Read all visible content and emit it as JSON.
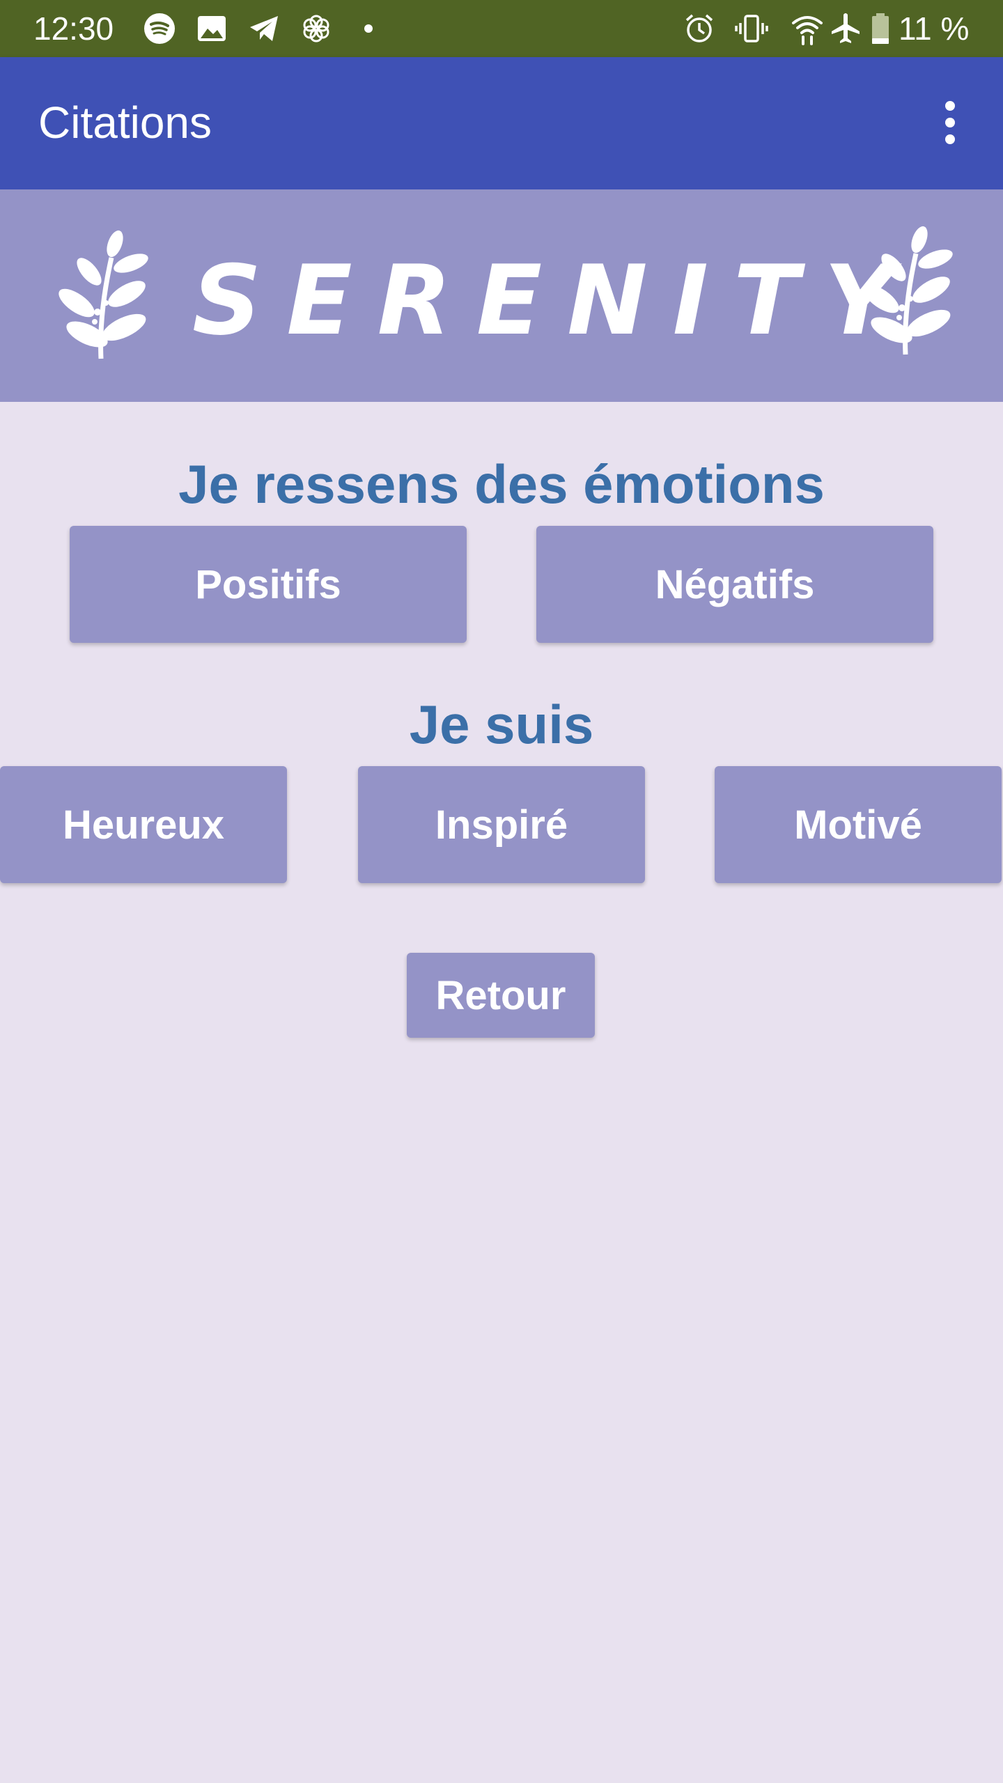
{
  "status_bar": {
    "time": "12:30",
    "battery": "11 %",
    "left_icons": [
      "spotify-icon",
      "image-icon",
      "telegram-icon",
      "flower-icon",
      "dot-icon"
    ],
    "right_icons": [
      "alarm-icon",
      "vibrate-icon",
      "wifi-icon",
      "airplane-icon",
      "battery-icon"
    ]
  },
  "app_bar": {
    "title": "Citations",
    "menu_icon": "more-vert-icon"
  },
  "banner": {
    "logo_text": "SERENITY",
    "left_icon": "leaf-branch-icon",
    "right_icon": "leaf-branch-icon"
  },
  "emotions_section": {
    "heading": "Je ressens des émotions",
    "buttons": [
      "Positifs",
      "Négatifs"
    ]
  },
  "mood_section": {
    "heading": "Je suis",
    "buttons": [
      "Heureux",
      "Inspiré",
      "Motivé"
    ]
  },
  "back_button": "Retour",
  "colors": {
    "status_bar_bg": "#506424",
    "app_bar_bg": "#3f51b5",
    "banner_bg": "#9493c7",
    "page_bg": "#e8e1ef",
    "heading_text": "#3b6fa8",
    "button_bg": "#9493c7",
    "button_text": "#ffffff"
  }
}
